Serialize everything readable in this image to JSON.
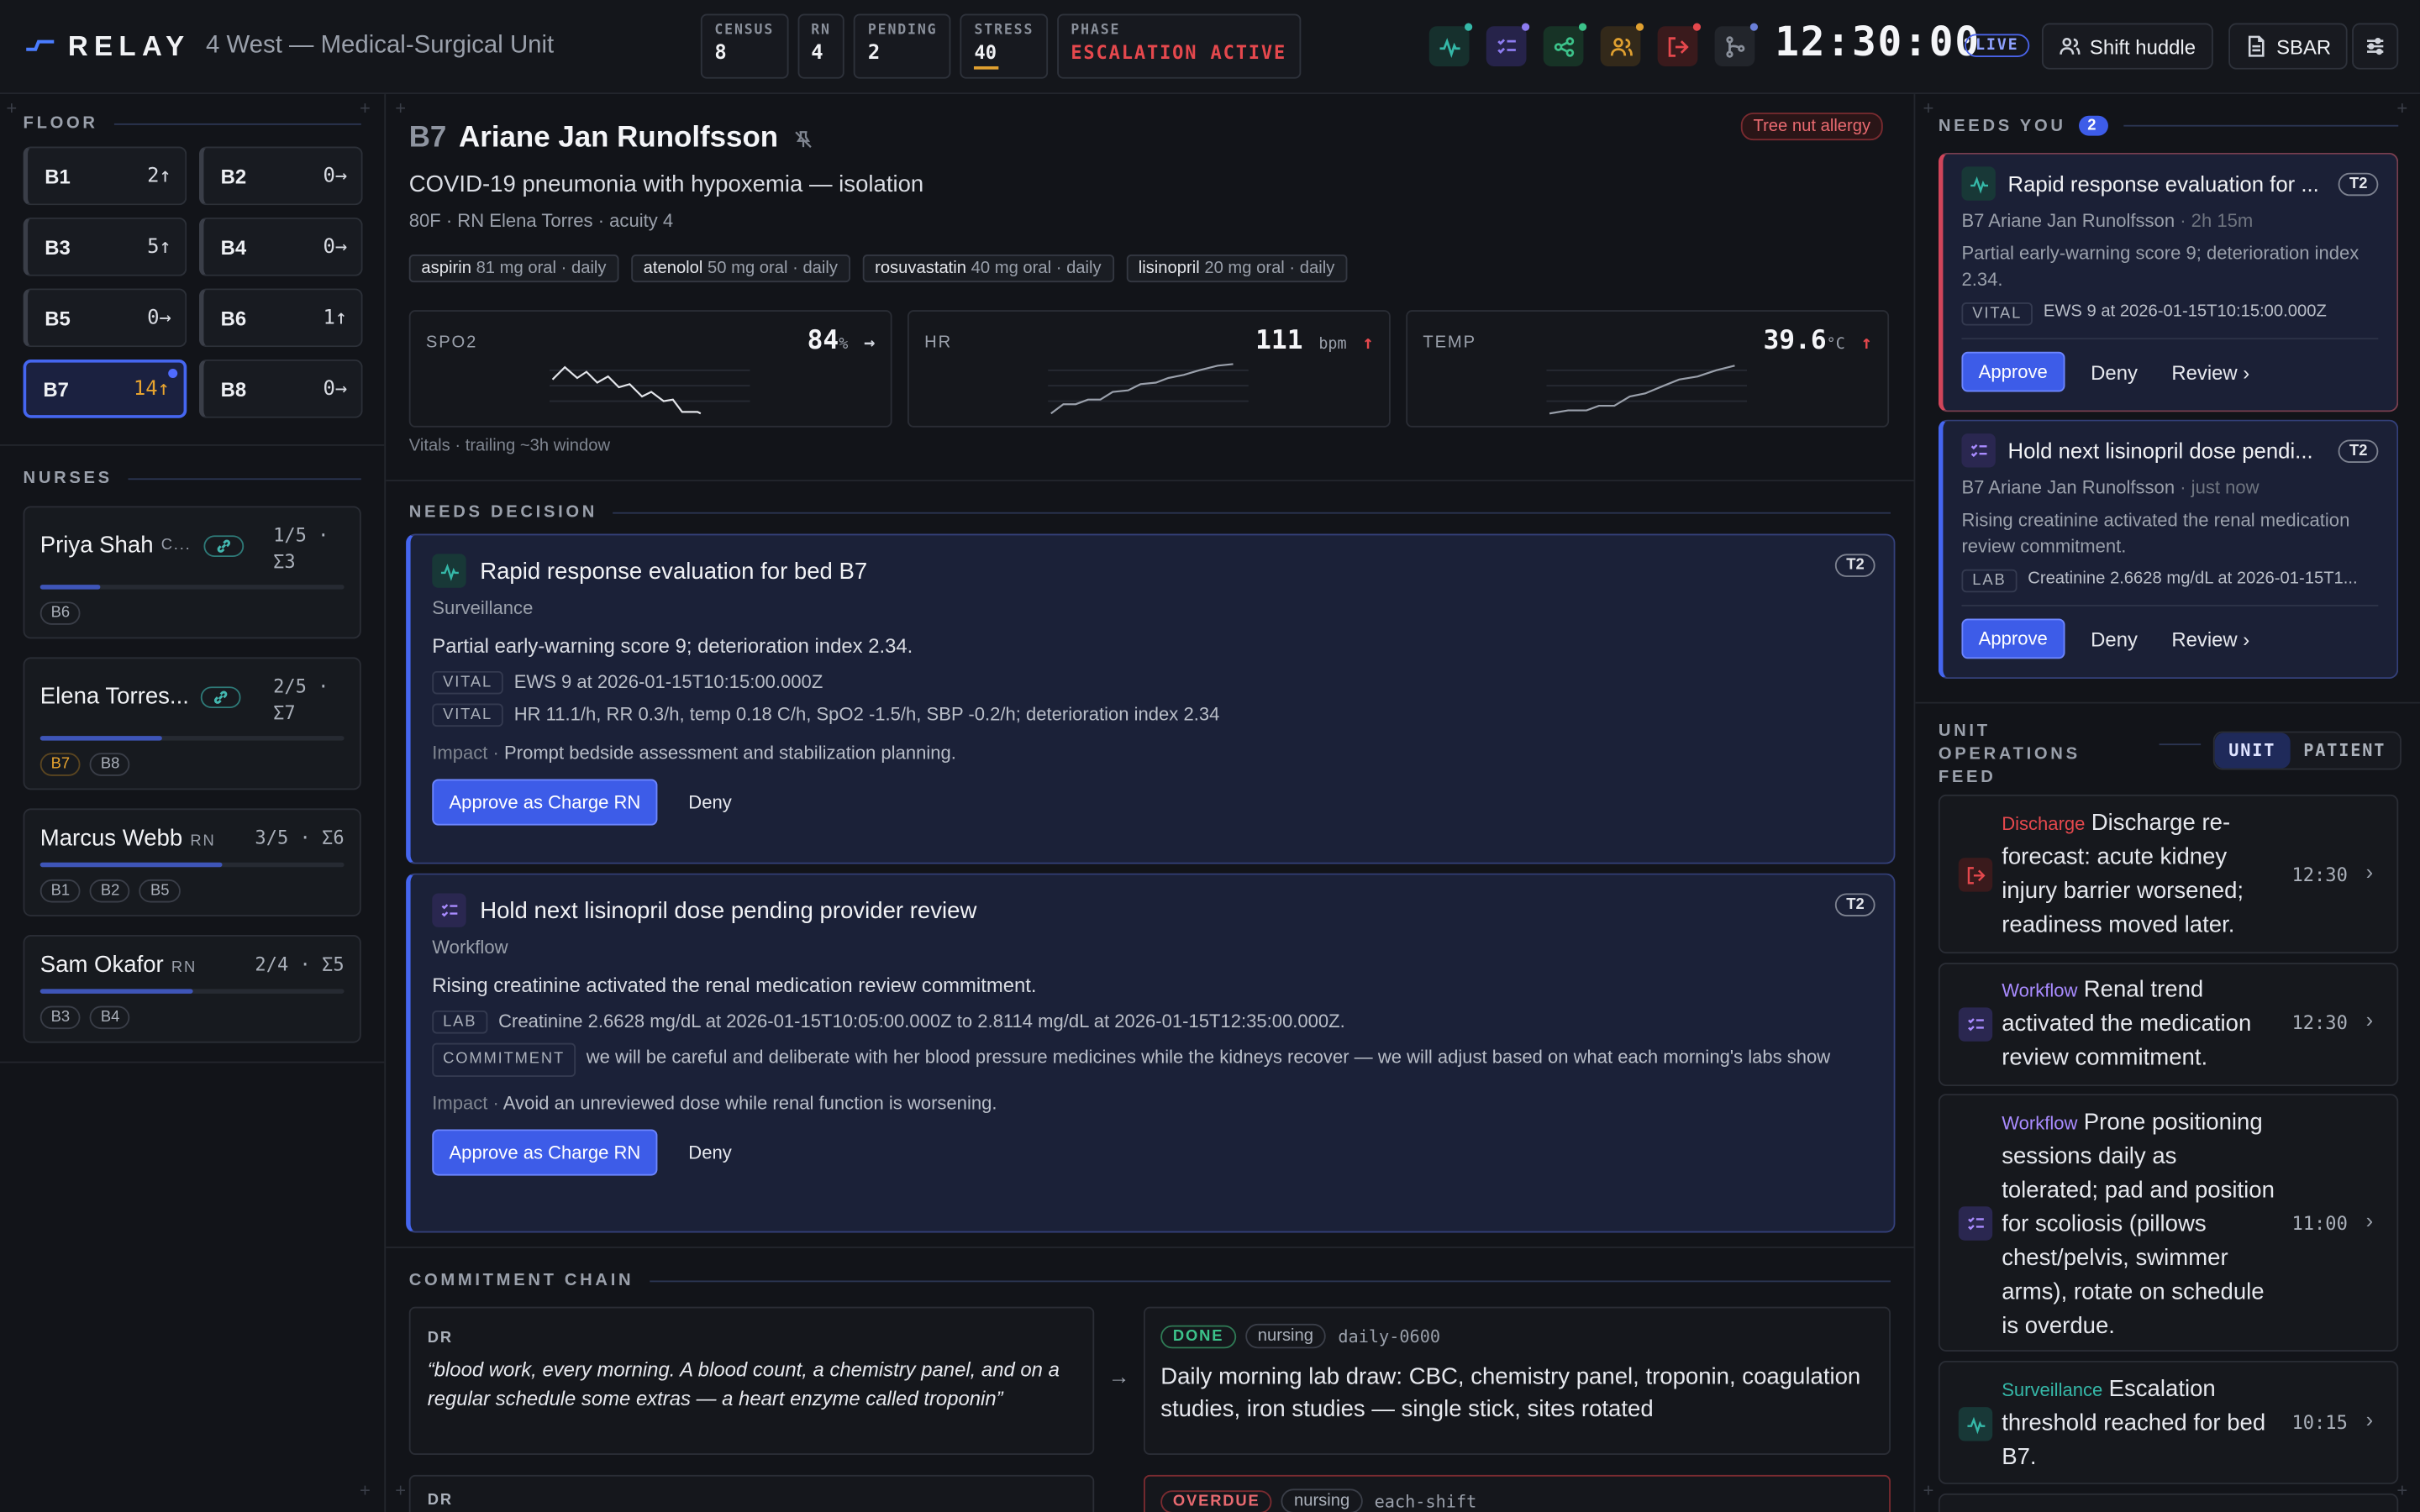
{
  "header": {
    "app": "RELAY",
    "unit": "4 West — Medical-Surgical Unit",
    "stats": [
      {
        "k": "CENSUS",
        "v": "8"
      },
      {
        "k": "RN",
        "v": "4"
      },
      {
        "k": "PENDING",
        "v": "2"
      },
      {
        "k": "STRESS",
        "v": "40"
      }
    ],
    "stress_fraction": 0.4,
    "phase_label": "PHASE",
    "phase_value": "ESCALATION ACTIVE",
    "tools": [
      {
        "icon": "vitals-icon",
        "color": "#35b8a8"
      },
      {
        "icon": "checklist-icon",
        "color": "#8d7cf0"
      },
      {
        "icon": "share-icon",
        "color": "#3cc28a"
      },
      {
        "icon": "team-icon",
        "color": "#e0a030"
      },
      {
        "icon": "exit-icon",
        "color": "#e5484d"
      },
      {
        "icon": "branch-icon",
        "color": "#8a909b"
      }
    ],
    "clock": "12:30:00",
    "live": "LIVE",
    "huddle": "Shift huddle",
    "sbar": "SBAR"
  },
  "floor": {
    "title": "FLOOR",
    "beds": [
      {
        "name": "B1",
        "count": "2↑"
      },
      {
        "name": "B2",
        "count": "0→"
      },
      {
        "name": "B3",
        "count": "5↑"
      },
      {
        "name": "B4",
        "count": "0→"
      },
      {
        "name": "B5",
        "count": "0→"
      },
      {
        "name": "B6",
        "count": "1↑"
      },
      {
        "name": "B7",
        "count": "14↑"
      },
      {
        "name": "B8",
        "count": "0→"
      }
    ]
  },
  "nurses": {
    "title": "NURSES",
    "items": [
      {
        "name": "Priya Shah",
        "role": "C...",
        "load": "1/5 ·",
        "sum": "Σ3",
        "progress": 0.2,
        "beds": [
          "B6"
        ]
      },
      {
        "name": "Elena Torres...",
        "role": "",
        "load": "2/5 ·",
        "sum": "Σ7",
        "progress": 0.4,
        "beds": [
          "B7",
          "B8"
        ]
      },
      {
        "name": "Marcus Webb",
        "role": "RN",
        "load": "3/5 · Σ6",
        "progress": 0.6,
        "beds": [
          "B1",
          "B2",
          "B5"
        ]
      },
      {
        "name": "Sam Okafor",
        "role": "RN",
        "load": "2/4 · Σ5",
        "progress": 0.5,
        "beds": [
          "B3",
          "B4"
        ]
      }
    ]
  },
  "patient": {
    "bed": "B7",
    "name": "Ariane Jan Runolfsson",
    "allergy": "Tree nut allergy",
    "dx": "COVID-19 pneumonia with hypoxemia — isolation",
    "meta": "80F · RN Elena Torres · acuity 4",
    "meds": [
      {
        "n": "aspirin",
        "d": "81 mg oral · daily"
      },
      {
        "n": "atenolol",
        "d": "50 mg oral · daily"
      },
      {
        "n": "rosuvastatin",
        "d": "40 mg oral · daily"
      },
      {
        "n": "lisinopril",
        "d": "20 mg oral · daily"
      }
    ],
    "vitals": [
      {
        "label": "SPO2",
        "value": "84",
        "unit": "%",
        "trend": "→"
      },
      {
        "label": "HR",
        "value": "111",
        "unit": "bpm",
        "trend": "↑"
      },
      {
        "label": "TEMP",
        "value": "39.6",
        "unit": "°C",
        "trend": "↑"
      }
    ],
    "vitals_note": "Vitals · trailing ~3h window"
  },
  "decisions": {
    "title": "NEEDS DECISION",
    "items": [
      {
        "title": "Rapid response evaluation for bed B7",
        "tier": "T2",
        "cat": "Surveillance",
        "sum": "Partial early-warning score 9; deterioration index 2.34.",
        "ev": [
          {
            "tag": "VITAL",
            "text": "EWS 9 at 2026-01-15T10:15:00.000Z"
          },
          {
            "tag": "VITAL",
            "text": "HR 11.1/h, RR 0.3/h, temp 0.18 C/h, SpO2 -1.5/h, SBP -0.2/h; deterioration index 2.34"
          }
        ],
        "impact_label": "Impact ·",
        "impact": "Prompt bedside assessment and stabilization planning.",
        "approve": "Approve as Charge RN",
        "deny": "Deny"
      },
      {
        "title": "Hold next lisinopril dose pending provider review",
        "tier": "T2",
        "cat": "Workflow",
        "sum": "Rising creatinine activated the renal medication review commitment.",
        "ev": [
          {
            "tag": "LAB",
            "text": "Creatinine 2.6628 mg/dL at 2026-01-15T10:05:00.000Z to 2.8114 mg/dL at 2026-01-15T12:35:00.000Z."
          },
          {
            "tag": "COMMITMENT",
            "text": "we will be careful and deliberate with her blood pressure medicines while the kidneys recover — we will adjust based on what each morning's labs show"
          }
        ],
        "impact_label": "Impact ·",
        "impact": "Avoid an unreviewed dose while renal function is worsening.",
        "approve": "Approve as Charge RN",
        "deny": "Deny"
      }
    ]
  },
  "chain": {
    "title": "COMMITMENT CHAIN",
    "items": [
      {
        "who": "DR",
        "quote": "“blood work, every morning. A blood count, a chemistry panel, and on a regular schedule some extras — a heart enzyme called troponin”",
        "status": "DONE",
        "owner": "nursing",
        "sched": "daily-0600",
        "task": "Daily morning lab draw: CBC, chemistry panel, troponin, coagulation studies, iron studies — single stick, sites rotated"
      },
      {
        "who": "DR",
        "status": "OVERDUE",
        "owner": "nursing",
        "sched": "each-shift"
      }
    ]
  },
  "needs_you": {
    "title": "NEEDS YOU",
    "count": "2",
    "items": [
      {
        "title": "Rapid response evaluation for ...",
        "tier": "T2",
        "bed": "B7 Ariane Jan Runolfsson",
        "age": "· 2h 15m",
        "desc": "Partial early-warning score 9; deterioration index 2.34.",
        "tag": "VITAL",
        "ev": "EWS 9 at 2026-01-15T10:15:00.000Z",
        "approve": "Approve",
        "deny": "Deny",
        "review": "Review"
      },
      {
        "title": "Hold next lisinopril dose pendi...",
        "tier": "T2",
        "bed": "B7 Ariane Jan Runolfsson",
        "age": "· just now",
        "desc": "Rising creatinine activated the renal medication review commitment.",
        "tag": "LAB",
        "ev": "Creatinine 2.6628 mg/dL at 2026-01-15T1...",
        "approve": "Approve",
        "deny": "Deny",
        "review": "Review"
      }
    ]
  },
  "feed": {
    "title": "UNIT OPERATIONS FEED",
    "tabs": [
      "UNIT",
      "PATIENT"
    ],
    "items": [
      {
        "cat": "Discharge",
        "color": "#e5484d",
        "text": "Discharge re-forecast: acute kidney injury barrier worsened; readiness moved later.",
        "time": "12:30"
      },
      {
        "cat": "Workflow",
        "color": "#a98bff",
        "text": "Renal trend activated the medication review commitment.",
        "time": "12:30"
      },
      {
        "cat": "Workflow",
        "color": "#a98bff",
        "text": "Prone positioning sessions daily as tolerated; pad and position for scoliosis (pillows chest/pelvis, swimmer arms), rotate on schedule is overdue.",
        "time": "11:00"
      },
      {
        "cat": "Surveillance",
        "color": "#35b8a8",
        "text": "Escalation threshold reached for bed B7.",
        "time": "10:15"
      }
    ]
  }
}
